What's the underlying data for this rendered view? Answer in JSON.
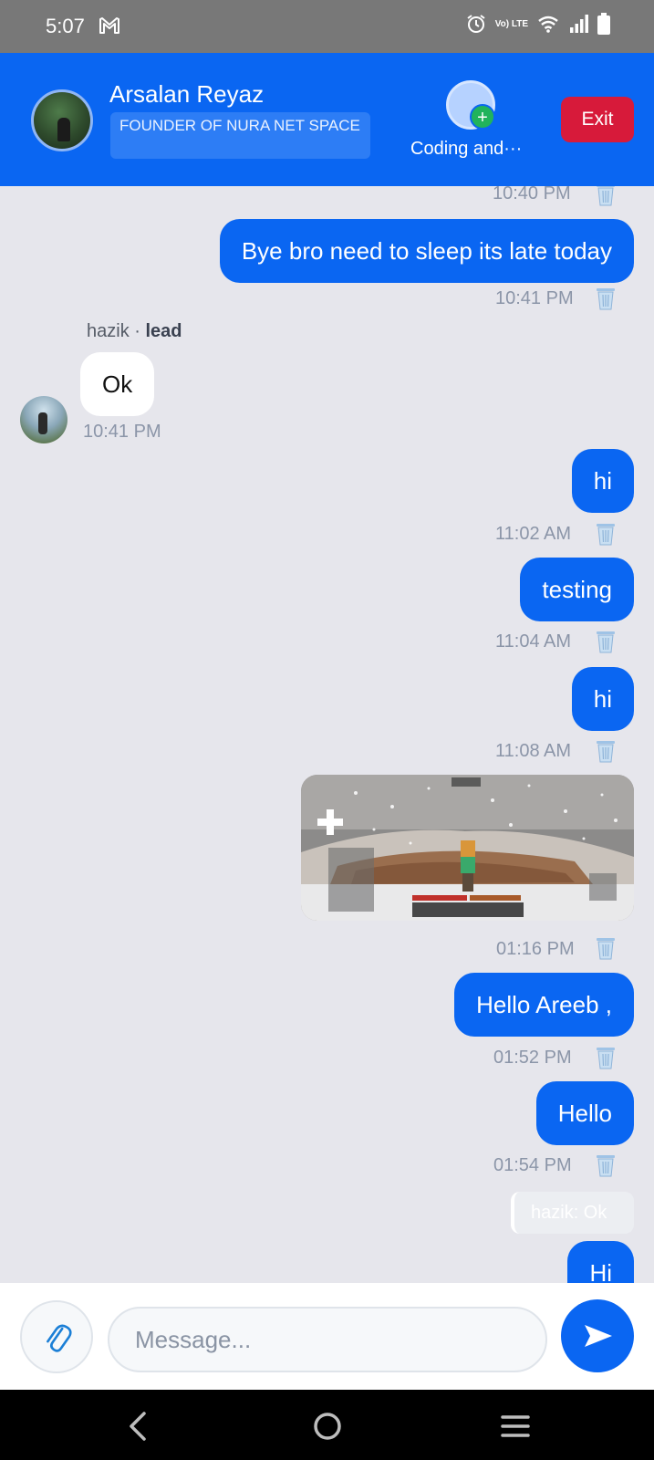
{
  "status_bar": {
    "time": "5:07",
    "volte_label": "Vo) LTE"
  },
  "header": {
    "user_name": "Arsalan Reyaz",
    "user_role": "FOUNDER OF NURA NET SPACE",
    "status_label": "Coding and···",
    "status_add": "+",
    "exit_label": "Exit"
  },
  "messages": [
    {
      "direction": "out",
      "time": "10:40 PM"
    },
    {
      "direction": "out",
      "text": "Bye bro need to sleep its late today",
      "time": "10:41 PM"
    },
    {
      "direction": "in",
      "sender": "hazik",
      "sender_tag": "lead",
      "separator": "·",
      "text": "Ok",
      "time": "10:41 PM"
    },
    {
      "direction": "out",
      "text": "hi",
      "time": "11:02 AM"
    },
    {
      "direction": "out",
      "text": "testing",
      "time": "11:04 AM"
    },
    {
      "direction": "out",
      "text": "hi",
      "time": "11:08 AM"
    },
    {
      "direction": "out",
      "type": "image",
      "time": "01:16 PM"
    },
    {
      "direction": "out",
      "text": "Hello Areeb ,",
      "time": "01:52 PM"
    },
    {
      "direction": "out",
      "text": "Hello",
      "time": "01:54 PM"
    },
    {
      "direction": "out",
      "reply_to": "hazik: Ok",
      "text": "Hi"
    }
  ],
  "composer": {
    "placeholder": "Message..."
  },
  "colors": {
    "primary": "#0a66f2",
    "exit": "#d71a3a",
    "chat_bg": "#e6e6ec"
  },
  "icons": {
    "attach": "paperclip-icon",
    "send": "send-icon",
    "delete": "trash-icon"
  }
}
